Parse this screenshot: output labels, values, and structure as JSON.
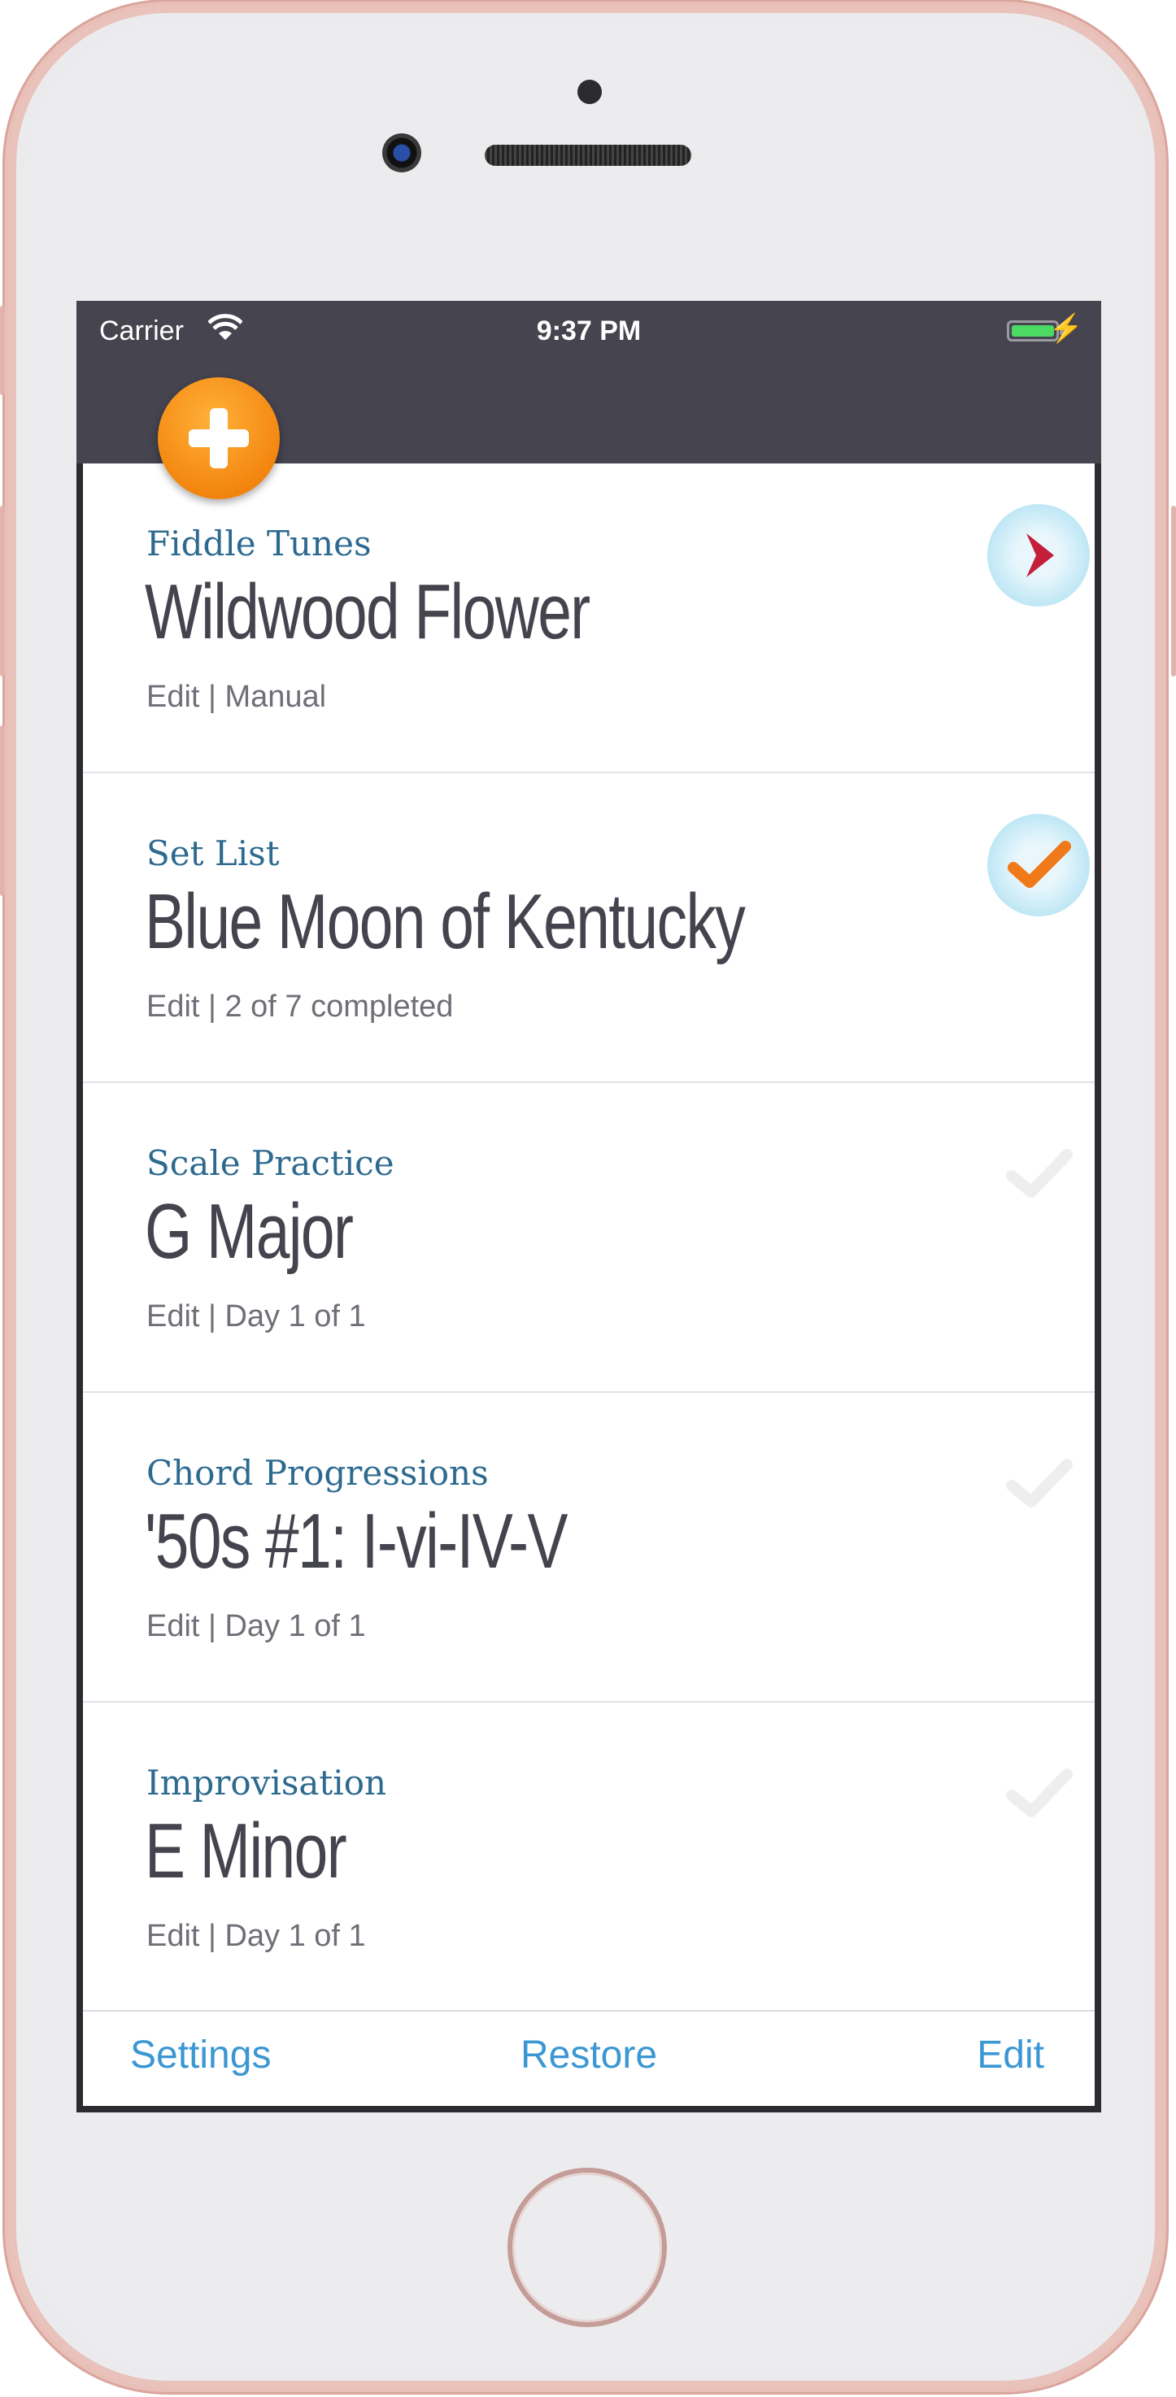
{
  "status_bar": {
    "carrier": "Carrier",
    "time": "9:37 PM"
  },
  "add_button": {
    "icon": "plus-icon",
    "color": "#f3860f"
  },
  "items": [
    {
      "category": "Fiddle Tunes",
      "title": "Wildwood Flower",
      "meta": "Edit | Manual",
      "status_icon": "play-icon"
    },
    {
      "category": "Set List",
      "title": "Blue Moon of Kentucky",
      "meta": "Edit | 2 of 7 completed",
      "status_icon": "checkmark-icon-active"
    },
    {
      "category": "Scale Practice",
      "title": "G Major",
      "meta": "Edit | Day 1 of 1",
      "status_icon": "checkmark-icon"
    },
    {
      "category": "Chord Progressions",
      "title": "'50s #1:  I-vi-IV-V",
      "meta": "Edit | Day 1 of 1",
      "status_icon": "checkmark-icon"
    },
    {
      "category": "Improvisation",
      "title": "E Minor",
      "meta": "Edit | Day 1 of 1",
      "status_icon": "checkmark-icon"
    }
  ],
  "toolbar": {
    "settings_label": "Settings",
    "restore_label": "Restore",
    "edit_label": "Edit"
  },
  "colors": {
    "header": "#45444f",
    "category_text": "#2d6a8f",
    "toolbar_text": "#3b97d3",
    "accent": "#f3860f"
  }
}
